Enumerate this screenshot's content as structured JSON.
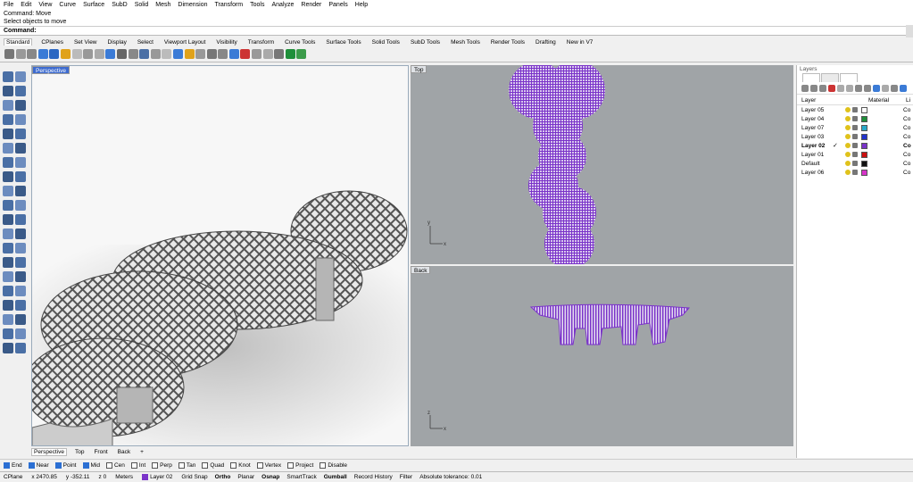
{
  "menu": [
    "File",
    "Edit",
    "View",
    "Curve",
    "Surface",
    "SubD",
    "Solid",
    "Mesh",
    "Dimension",
    "Transform",
    "Tools",
    "Analyze",
    "Render",
    "Panels",
    "Help"
  ],
  "command": {
    "history1": "Command: Move",
    "history2": "Select objects to move",
    "prompt": "Command:"
  },
  "toolbar_tabs": [
    "Standard",
    "CPlanes",
    "Set View",
    "Display",
    "Select",
    "Viewport Layout",
    "Visibility",
    "Transform",
    "Curve Tools",
    "Surface Tools",
    "Solid Tools",
    "SubD Tools",
    "Mesh Tools",
    "Render Tools",
    "Drafting",
    "New in V7"
  ],
  "viewports": {
    "perspective": "Perspective",
    "top": "Top",
    "back": "Back"
  },
  "viewport_tabs": [
    "Perspective",
    "Top",
    "Front",
    "Back"
  ],
  "osnaps": [
    {
      "label": "End",
      "on": true
    },
    {
      "label": "Near",
      "on": true
    },
    {
      "label": "Point",
      "on": true
    },
    {
      "label": "Mid",
      "on": true
    },
    {
      "label": "Cen",
      "on": false
    },
    {
      "label": "Int",
      "on": false
    },
    {
      "label": "Perp",
      "on": false
    },
    {
      "label": "Tan",
      "on": false
    },
    {
      "label": "Quad",
      "on": false
    },
    {
      "label": "Knot",
      "on": false
    },
    {
      "label": "Vertex",
      "on": false
    },
    {
      "label": "Project",
      "on": false
    },
    {
      "label": "Disable",
      "on": false
    }
  ],
  "status": {
    "cplane": "CPlane",
    "x": "x 2470.85",
    "y": "y -352.11",
    "z": "z 0",
    "units": "Meters",
    "layer": "Layer 02",
    "layer_color": "#7a33c9",
    "toggles": [
      "Grid Snap",
      "Ortho",
      "Planar",
      "Osnap",
      "SmartTrack",
      "Gumball",
      "Record History",
      "Filter"
    ],
    "tolerance": "Absolute tolerance: 0.01"
  },
  "layers_panel": {
    "title": "Layers",
    "col_layer": "Layer",
    "col_material": "Material",
    "col_li": "Li",
    "rows": [
      {
        "name": "Layer 05",
        "current": false,
        "color": "#ffffff",
        "co": "Co"
      },
      {
        "name": "Layer 04",
        "current": false,
        "color": "#1f8f3a",
        "co": "Co"
      },
      {
        "name": "Layer 07",
        "current": false,
        "color": "#2aa9c9",
        "co": "Co"
      },
      {
        "name": "Layer 03",
        "current": false,
        "color": "#2233cc",
        "co": "Co"
      },
      {
        "name": "Layer 02",
        "current": true,
        "color": "#7a33c9",
        "co": "Co"
      },
      {
        "name": "Layer 01",
        "current": false,
        "color": "#cc1111",
        "co": "Co"
      },
      {
        "name": "Default",
        "current": false,
        "color": "#111111",
        "co": "Co"
      },
      {
        "name": "Layer 06",
        "current": false,
        "color": "#d633c9",
        "co": "Co"
      }
    ]
  },
  "colors": {
    "accent": "#3d6bcf",
    "viewport_gray": "#a0a4a7",
    "model_purple": "#7a33c9"
  }
}
